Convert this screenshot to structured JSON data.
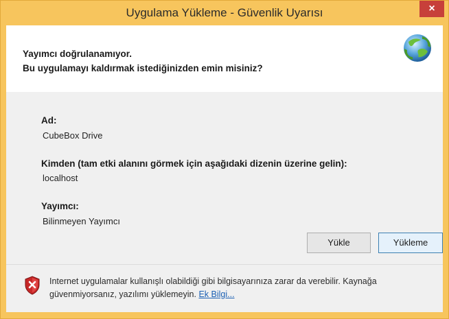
{
  "window": {
    "title": "Uygulama Yükleme - Güvenlik Uyarısı",
    "close_label": "×"
  },
  "header": {
    "line1": "Yayımcı doğrulanamıyor.",
    "line2": "Bu uygulamayı kaldırmak istediğinizden emin misiniz?",
    "icon": "application-globe-icon"
  },
  "details": {
    "name_label": "Ad:",
    "name_value": "CubeBox Drive",
    "from_label": "Kimden (tam etki alanını görmek için aşağıdaki dizenin üzerine gelin):",
    "from_value": "localhost",
    "publisher_label": "Yayımcı:",
    "publisher_value": "Bilinmeyen Yayımcı"
  },
  "buttons": {
    "install": "Yükle",
    "dont_install": "Yükleme"
  },
  "footer": {
    "warning_text": "Internet uygulamalar kullanışlı olabildiği gibi bilgisayarınıza zarar da verebilir. Kaynağa güvenmiyorsanız, yazılımı yüklemeyin.",
    "more_info_link": "Ek Bilgi...",
    "icon": "security-warning-shield-icon"
  },
  "colors": {
    "frame": "#f7c55d",
    "close_button": "#c7403a",
    "link": "#1a5fb4"
  }
}
